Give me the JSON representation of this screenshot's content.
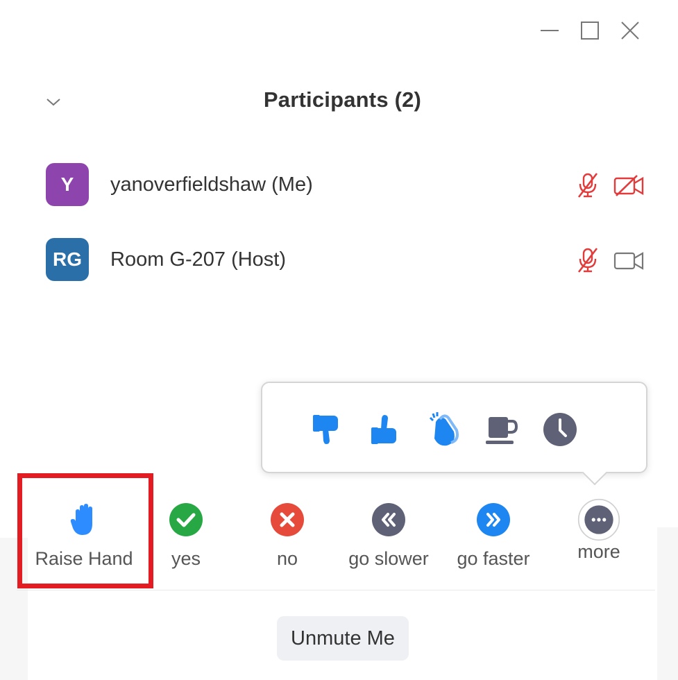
{
  "window_controls": {
    "minimize_icon": "minimize-icon",
    "maximize_icon": "maximize-icon",
    "close_icon": "close-icon"
  },
  "panel": {
    "title": "Participants (2)",
    "collapse_icon": "chevron-down-icon"
  },
  "participants": [
    {
      "initials": "Y",
      "name": "yanoverfieldshaw (Me)",
      "avatar_color": "#8e44ad",
      "audio": "muted",
      "video": "off"
    },
    {
      "initials": "RG",
      "name": "Room G-207 (Host)",
      "avatar_color": "#2a6fa8",
      "audio": "muted",
      "video": "on"
    }
  ],
  "more_popover": {
    "items": [
      {
        "name": "thumbs-down-icon"
      },
      {
        "name": "thumbs-up-icon"
      },
      {
        "name": "clapping-hands-icon"
      },
      {
        "name": "coffee-cup-icon"
      },
      {
        "name": "clock-icon"
      }
    ]
  },
  "reactions": [
    {
      "label": "Raise Hand",
      "icon": "raise-hand-icon"
    },
    {
      "label": "yes",
      "icon": "check-icon",
      "color": "#27a844"
    },
    {
      "label": "no",
      "icon": "x-icon",
      "color": "#e64a3b"
    },
    {
      "label": "go slower",
      "icon": "rewind-icon",
      "color": "#5f6177"
    },
    {
      "label": "go faster",
      "icon": "fast-forward-icon",
      "color": "#1e86f0"
    },
    {
      "label": "more",
      "icon": "more-icon",
      "color": "#5f6177"
    }
  ],
  "footer": {
    "unmute_label": "Unmute Me"
  },
  "colors": {
    "accent_blue": "#2d8cff",
    "muted_red": "#e23b3b",
    "highlight_red": "#e31b23"
  }
}
